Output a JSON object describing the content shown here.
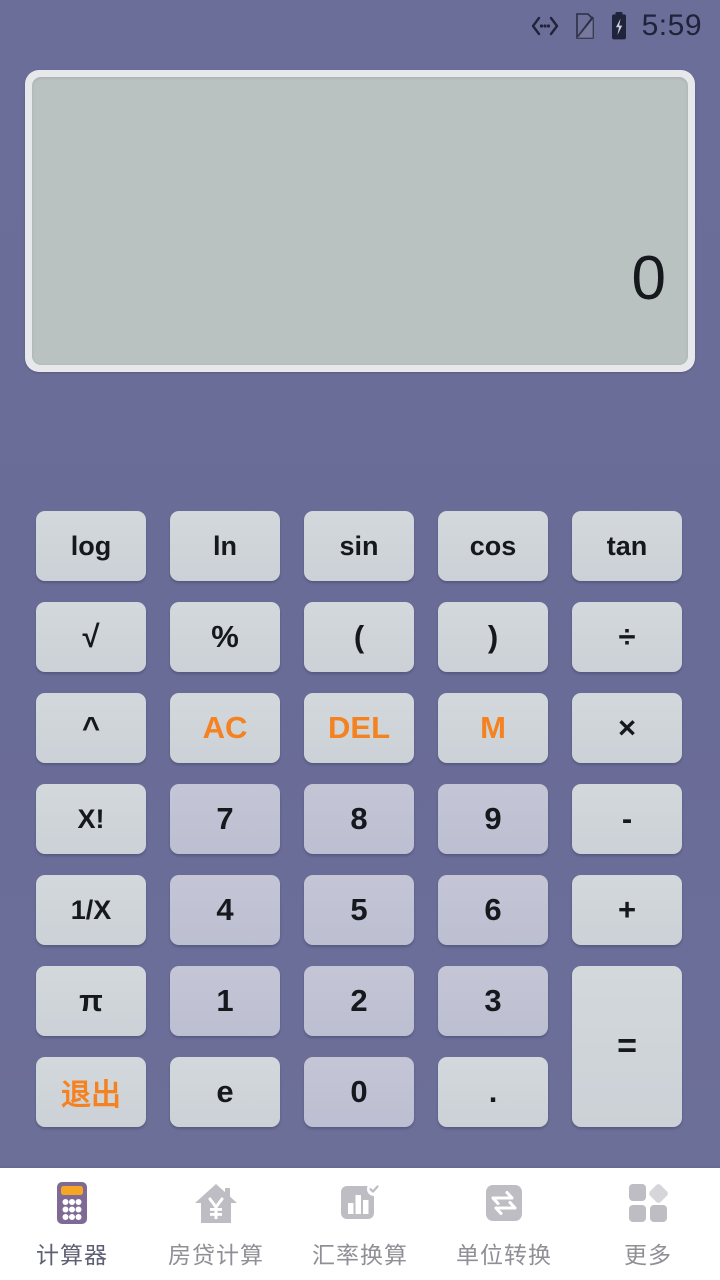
{
  "statusbar": {
    "time": "5:59",
    "icons": [
      {
        "name": "data-transfer-icon",
        "glyph": "‹···›"
      },
      {
        "name": "no-sim-icon",
        "glyph": "sim"
      },
      {
        "name": "battery-charging-icon",
        "glyph": "battery"
      }
    ]
  },
  "display": {
    "value": "0"
  },
  "keypad": {
    "rows": [
      [
        {
          "label": "log",
          "name": "key-log",
          "style": "func"
        },
        {
          "label": "ln",
          "name": "key-ln",
          "style": "func"
        },
        {
          "label": "sin",
          "name": "key-sin",
          "style": "func"
        },
        {
          "label": "cos",
          "name": "key-cos",
          "style": "func"
        },
        {
          "label": "tan",
          "name": "key-tan",
          "style": "func"
        }
      ],
      [
        {
          "label": "√",
          "name": "key-sqrt",
          "style": "func"
        },
        {
          "label": "%",
          "name": "key-percent",
          "style": "func"
        },
        {
          "label": "(",
          "name": "key-paren-open",
          "style": "func"
        },
        {
          "label": ")",
          "name": "key-paren-close",
          "style": "func"
        },
        {
          "label": "÷",
          "name": "key-divide",
          "style": "func"
        }
      ],
      [
        {
          "label": "^",
          "name": "key-power",
          "style": "func"
        },
        {
          "label": "AC",
          "name": "key-ac",
          "style": "accent"
        },
        {
          "label": "DEL",
          "name": "key-del",
          "style": "accent"
        },
        {
          "label": "M",
          "name": "key-memory",
          "style": "accent"
        },
        {
          "label": "×",
          "name": "key-multiply",
          "style": "func"
        }
      ],
      [
        {
          "label": "X!",
          "name": "key-factorial",
          "style": "func"
        },
        {
          "label": "7",
          "name": "key-7",
          "style": "digit"
        },
        {
          "label": "8",
          "name": "key-8",
          "style": "digit"
        },
        {
          "label": "9",
          "name": "key-9",
          "style": "digit"
        },
        {
          "label": "-",
          "name": "key-minus",
          "style": "func"
        }
      ],
      [
        {
          "label": "1/X",
          "name": "key-reciprocal",
          "style": "func"
        },
        {
          "label": "4",
          "name": "key-4",
          "style": "digit"
        },
        {
          "label": "5",
          "name": "key-5",
          "style": "digit"
        },
        {
          "label": "6",
          "name": "key-6",
          "style": "digit"
        },
        {
          "label": "+",
          "name": "key-plus",
          "style": "func"
        }
      ],
      [
        {
          "label": "π",
          "name": "key-pi",
          "style": "func"
        },
        {
          "label": "1",
          "name": "key-1",
          "style": "digit"
        },
        {
          "label": "2",
          "name": "key-2",
          "style": "digit"
        },
        {
          "label": "3",
          "name": "key-3",
          "style": "digit"
        },
        {
          "label": "=",
          "name": "key-equals",
          "style": "equals"
        }
      ],
      [
        {
          "label": "退出",
          "name": "key-exit",
          "style": "accent-cjk"
        },
        {
          "label": "e",
          "name": "key-e",
          "style": "func"
        },
        {
          "label": "0",
          "name": "key-0",
          "style": "digit"
        },
        {
          "label": ".",
          "name": "key-decimal",
          "style": "func"
        }
      ]
    ]
  },
  "bottomnav": {
    "items": [
      {
        "label": "计算器",
        "name": "nav-calculator",
        "icon": "calculator-icon",
        "active": true
      },
      {
        "label": "房贷计算",
        "name": "nav-mortgage",
        "icon": "house-yen-icon",
        "active": false
      },
      {
        "label": "汇率换算",
        "name": "nav-exchange",
        "icon": "bar-chart-icon",
        "active": false
      },
      {
        "label": "单位转换",
        "name": "nav-unit",
        "icon": "swap-arrows-icon",
        "active": false
      },
      {
        "label": "更多",
        "name": "nav-more",
        "icon": "grid-more-icon",
        "active": false
      }
    ]
  },
  "colors": {
    "background": "#6a6d99",
    "accent_orange": "#f58220",
    "key_face": "#d0d5da",
    "digit_face": "#c0c3d3",
    "display_face": "#b9c1c1",
    "nav_inactive": "#bdbdc3",
    "nav_active_label": "#5d5f72"
  }
}
